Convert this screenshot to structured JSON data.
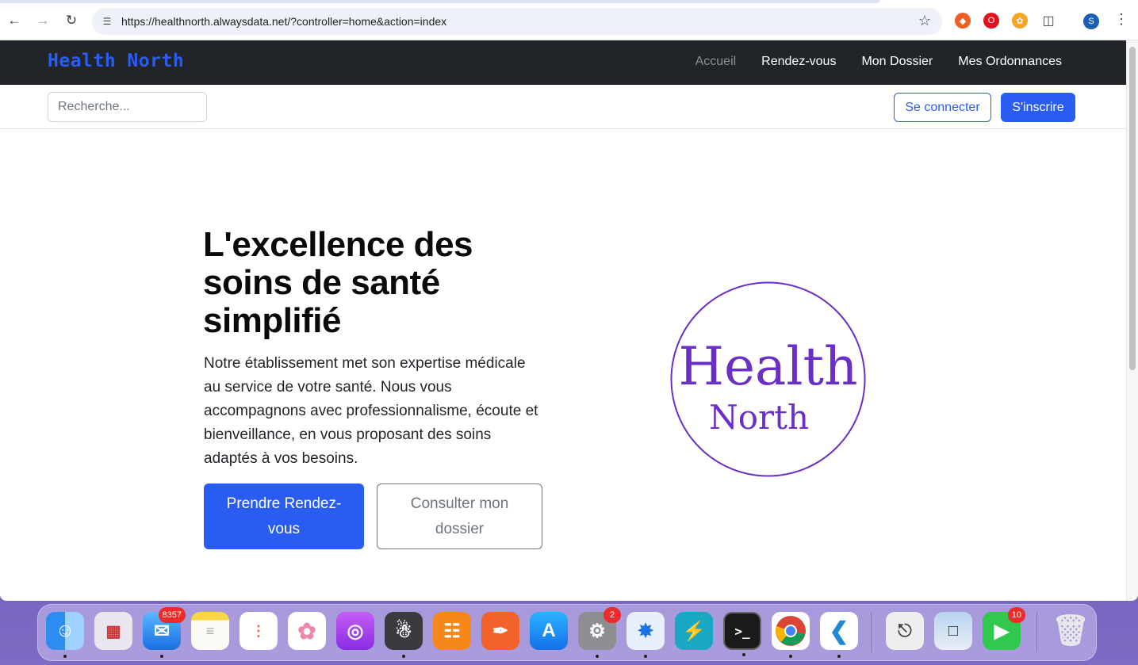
{
  "browser": {
    "url": "https://healthnorth.alwaysdata.net/?controller=home&action=index",
    "profile_initial": "S"
  },
  "navbar": {
    "brand": "Health North",
    "links": [
      "Accueil",
      "Rendez-vous",
      "Mon Dossier",
      "Mes Ordonnances"
    ],
    "active": "Accueil"
  },
  "toolbar": {
    "search_placeholder": "Recherche...",
    "login_label": "Se connecter",
    "signup_label": "S'inscrire"
  },
  "hero": {
    "title": "L'excellence des soins de santé simplifié",
    "text": "Notre établissement met son expertise médicale au service de votre santé. Nous vous accompagnons avec professionnalisme, écoute et bienveillance, en vous proposant des soins adaptés à vos besoins.",
    "cta_primary": "Prendre Rendez-vous",
    "cta_secondary": "Consulter mon dossier"
  },
  "logo": {
    "line1": "Health",
    "line2": "North",
    "color": "#6a2fc6"
  },
  "colors": {
    "primary": "#2b5cf2",
    "navbar": "#212529"
  },
  "dock": {
    "apps": [
      {
        "name": "finder-icon",
        "badge": ""
      },
      {
        "name": "launchpad-icon",
        "badge": ""
      },
      {
        "name": "mail-icon",
        "badge": "8357"
      },
      {
        "name": "notes-icon",
        "badge": ""
      },
      {
        "name": "reminders-icon",
        "badge": ""
      },
      {
        "name": "photos-icon",
        "badge": ""
      },
      {
        "name": "podcasts-icon",
        "badge": ""
      },
      {
        "name": "tableplus-icon",
        "badge": ""
      },
      {
        "name": "books-icon",
        "badge": ""
      },
      {
        "name": "postman-icon",
        "badge": ""
      },
      {
        "name": "app-store-icon",
        "badge": ""
      },
      {
        "name": "system-settings-icon",
        "badge": "2"
      },
      {
        "name": "safari-icon",
        "badge": ""
      },
      {
        "name": "electron-icon",
        "badge": ""
      },
      {
        "name": "terminal-icon",
        "badge": ""
      },
      {
        "name": "chrome-icon",
        "badge": ""
      },
      {
        "name": "vscode-icon",
        "badge": ""
      },
      {
        "name": "system-information-icon",
        "badge": ""
      },
      {
        "name": "preview-icon",
        "badge": ""
      },
      {
        "name": "facetime-icon",
        "badge": "10"
      },
      {
        "name": "trash-icon",
        "badge": ""
      }
    ]
  }
}
